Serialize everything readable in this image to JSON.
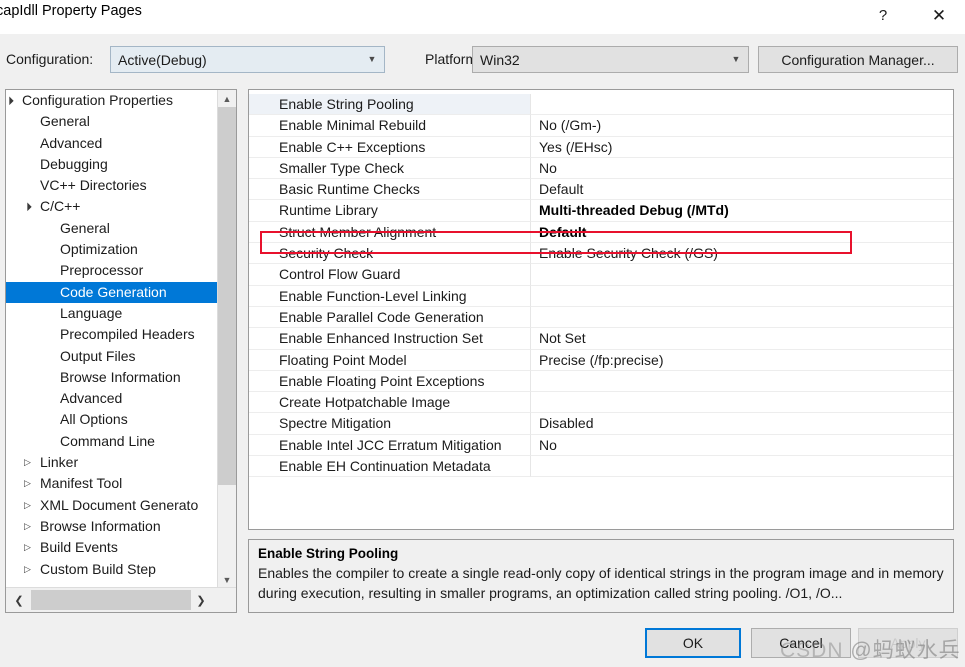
{
  "window": {
    "title": "capIdll Property Pages",
    "help_icon": "question-mark-icon",
    "close_icon": "close-x-icon"
  },
  "configbar": {
    "configuration_label": "Configuration:",
    "configuration_value": "Active(Debug)",
    "platform_label": "Platform:",
    "platform_value": "Win32",
    "configuration_manager_button": "Configuration Manager...",
    "dropdown_arrow_icon": "chevron-down-icon"
  },
  "tree": {
    "items": [
      {
        "label": "Configuration Properties",
        "indent": 0,
        "arrow": "expanded",
        "selected": false
      },
      {
        "label": "General",
        "indent": 1,
        "arrow": "none",
        "selected": false
      },
      {
        "label": "Advanced",
        "indent": 1,
        "arrow": "none",
        "selected": false
      },
      {
        "label": "Debugging",
        "indent": 1,
        "arrow": "none",
        "selected": false
      },
      {
        "label": "VC++ Directories",
        "indent": 1,
        "arrow": "none",
        "selected": false
      },
      {
        "label": "C/C++",
        "indent": 1,
        "arrow": "expanded",
        "selected": false
      },
      {
        "label": "General",
        "indent": 2,
        "arrow": "none",
        "selected": false
      },
      {
        "label": "Optimization",
        "indent": 2,
        "arrow": "none",
        "selected": false
      },
      {
        "label": "Preprocessor",
        "indent": 2,
        "arrow": "none",
        "selected": false
      },
      {
        "label": "Code Generation",
        "indent": 2,
        "arrow": "none",
        "selected": true
      },
      {
        "label": "Language",
        "indent": 2,
        "arrow": "none",
        "selected": false
      },
      {
        "label": "Precompiled Headers",
        "indent": 2,
        "arrow": "none",
        "selected": false
      },
      {
        "label": "Output Files",
        "indent": 2,
        "arrow": "none",
        "selected": false
      },
      {
        "label": "Browse Information",
        "indent": 2,
        "arrow": "none",
        "selected": false
      },
      {
        "label": "Advanced",
        "indent": 2,
        "arrow": "none",
        "selected": false
      },
      {
        "label": "All Options",
        "indent": 2,
        "arrow": "none",
        "selected": false
      },
      {
        "label": "Command Line",
        "indent": 2,
        "arrow": "none",
        "selected": false
      },
      {
        "label": "Linker",
        "indent": 1,
        "arrow": "collapsed",
        "selected": false
      },
      {
        "label": "Manifest Tool",
        "indent": 1,
        "arrow": "collapsed",
        "selected": false
      },
      {
        "label": "XML Document Generato",
        "indent": 1,
        "arrow": "collapsed",
        "selected": false
      },
      {
        "label": "Browse Information",
        "indent": 1,
        "arrow": "collapsed",
        "selected": false
      },
      {
        "label": "Build Events",
        "indent": 1,
        "arrow": "collapsed",
        "selected": false
      },
      {
        "label": "Custom Build Step",
        "indent": 1,
        "arrow": "collapsed",
        "selected": false
      }
    ],
    "scrollbar": {
      "up_arrow_icon": "chevron-up-icon",
      "down_arrow_icon": "chevron-down-icon",
      "left_arrow_icon": "chevron-left-icon",
      "right_arrow_icon": "chevron-right-icon"
    }
  },
  "grid": {
    "rows": [
      {
        "name": "Enable String Pooling",
        "value": "",
        "bold": false,
        "selected": true
      },
      {
        "name": "Enable Minimal Rebuild",
        "value": "No (/Gm-)",
        "bold": false,
        "selected": false
      },
      {
        "name": "Enable C++ Exceptions",
        "value": "Yes (/EHsc)",
        "bold": false,
        "selected": false
      },
      {
        "name": "Smaller Type Check",
        "value": "No",
        "bold": false,
        "selected": false
      },
      {
        "name": "Basic Runtime Checks",
        "value": "Default",
        "bold": false,
        "selected": false
      },
      {
        "name": "Runtime Library",
        "value": "Multi-threaded Debug (/MTd)",
        "bold": true,
        "selected": false
      },
      {
        "name": "Struct Member Alignment",
        "value": "Default",
        "bold": true,
        "selected": false
      },
      {
        "name": "Security Check",
        "value": "Enable Security Check (/GS)",
        "bold": false,
        "selected": false
      },
      {
        "name": "Control Flow Guard",
        "value": "",
        "bold": false,
        "selected": false
      },
      {
        "name": "Enable Function-Level Linking",
        "value": "",
        "bold": false,
        "selected": false
      },
      {
        "name": "Enable Parallel Code Generation",
        "value": "",
        "bold": false,
        "selected": false
      },
      {
        "name": "Enable Enhanced Instruction Set",
        "value": "Not Set",
        "bold": false,
        "selected": false
      },
      {
        "name": "Floating Point Model",
        "value": "Precise (/fp:precise)",
        "bold": false,
        "selected": false
      },
      {
        "name": "Enable Floating Point Exceptions",
        "value": "",
        "bold": false,
        "selected": false
      },
      {
        "name": "Create Hotpatchable Image",
        "value": "",
        "bold": false,
        "selected": false
      },
      {
        "name": "Spectre Mitigation",
        "value": "Disabled",
        "bold": false,
        "selected": false
      },
      {
        "name": "Enable Intel JCC Erratum Mitigation",
        "value": "No",
        "bold": false,
        "selected": false
      },
      {
        "name": "Enable EH Continuation Metadata",
        "value": "",
        "bold": false,
        "selected": false
      }
    ]
  },
  "annotation": {
    "color": "#e8112d",
    "target_row": "Struct Member Alignment"
  },
  "description": {
    "title": "Enable String Pooling",
    "body": "Enables the compiler to create a single read-only copy of identical strings in the program image and in memory during execution, resulting in smaller programs, an optimization called string pooling. /O1, /O..."
  },
  "buttons": {
    "ok": "OK",
    "cancel": "Cancel",
    "apply": "Apply"
  },
  "watermark": {
    "site": "CSDN",
    "user": "@蚂蚁水兵"
  }
}
